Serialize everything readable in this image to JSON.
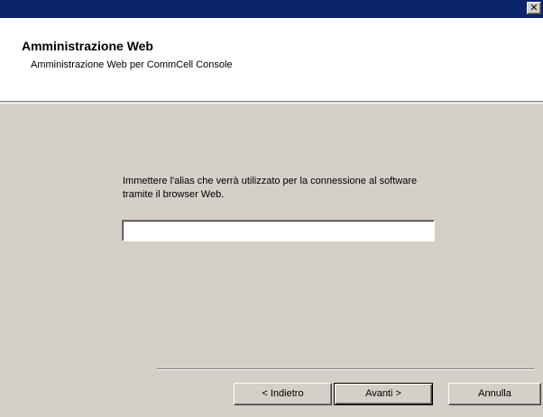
{
  "window": {
    "close_glyph": "✕"
  },
  "header": {
    "title": "Amministrazione Web",
    "subtitle": "Amministrazione Web per CommCell Console"
  },
  "main": {
    "prompt": "Immettere l'alias che verrà utilizzato per la connessione al software tramite il browser Web.",
    "alias_value": "",
    "alias_placeholder": ""
  },
  "buttons": {
    "back_label": "< Indietro",
    "next_label": "Avanti >",
    "cancel_label": "Annulla"
  }
}
